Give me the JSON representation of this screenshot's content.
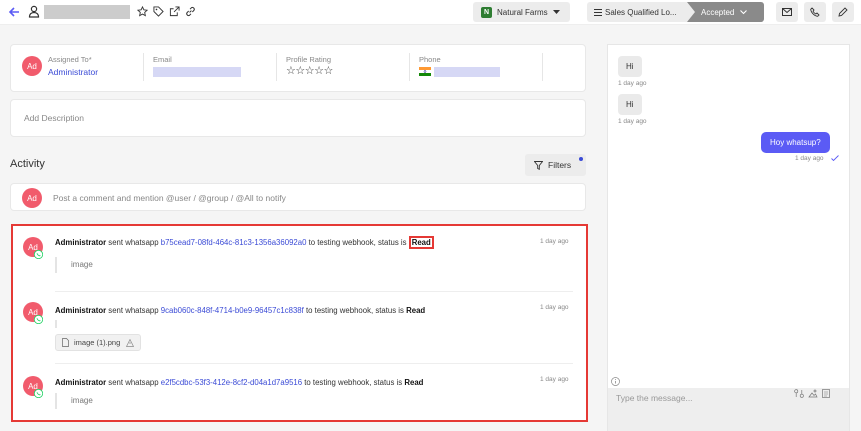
{
  "topbar": {
    "org_selector": "Natural Farms",
    "status_option": "Sales Qualified Lo...",
    "status_value": "Accepted"
  },
  "summary": {
    "avatar_initials": "Ad",
    "assigned_to_label": "Assigned To*",
    "assigned_to_value": "Administrator",
    "email_label": "Email",
    "profile_rating_label": "Profile Rating",
    "rating_stars": "☆☆☆☆☆",
    "phone_label": "Phone"
  },
  "description": {
    "placeholder": "Add Description"
  },
  "activity": {
    "title": "Activity",
    "filters_label": "Filters",
    "comment_avatar": "Ad",
    "comment_placeholder": "Post a comment and mention @user / @group / @All to notify",
    "entries": [
      {
        "avatar": "Ad",
        "user": "Administrator",
        "action": "sent whatsapp",
        "message_id": "b75cead7-08fd-464c-81c3-1356a36092a0",
        "target": "to testing webhook, status is",
        "status": "Read",
        "time": "1 day ago",
        "content": "image"
      },
      {
        "avatar": "Ad",
        "user": "Administrator",
        "action": "sent whatsapp",
        "message_id": "9cab060c-848f-4714-b0e9-96457c1c838f",
        "target": "to testing webhook, status is",
        "status": "Read",
        "time": "1 day ago",
        "attachment": "image (1).png"
      },
      {
        "avatar": "Ad",
        "user": "Administrator",
        "action": "sent whatsapp",
        "message_id": "e2f5cdbc-53f3-412e-8cf2-d04a1d7a9516",
        "target": "to testing webhook, status is",
        "status": "Read",
        "time": "1 day ago",
        "content": "image"
      }
    ]
  },
  "chat": {
    "messages": [
      {
        "text": "Hi",
        "time": "1 day ago",
        "direction": "incoming"
      },
      {
        "text": "Hi",
        "time": "1 day ago",
        "direction": "incoming"
      },
      {
        "text": "Hoy whatsup?",
        "time": "1 day ago",
        "direction": "outgoing"
      }
    ],
    "input_placeholder": "Type the message..."
  },
  "colors": {
    "accent": "#5b5bf5",
    "link": "#3b4bd6",
    "highlight_border": "#e53935",
    "avatar": "#f15b6c",
    "whatsapp": "#25d366"
  }
}
